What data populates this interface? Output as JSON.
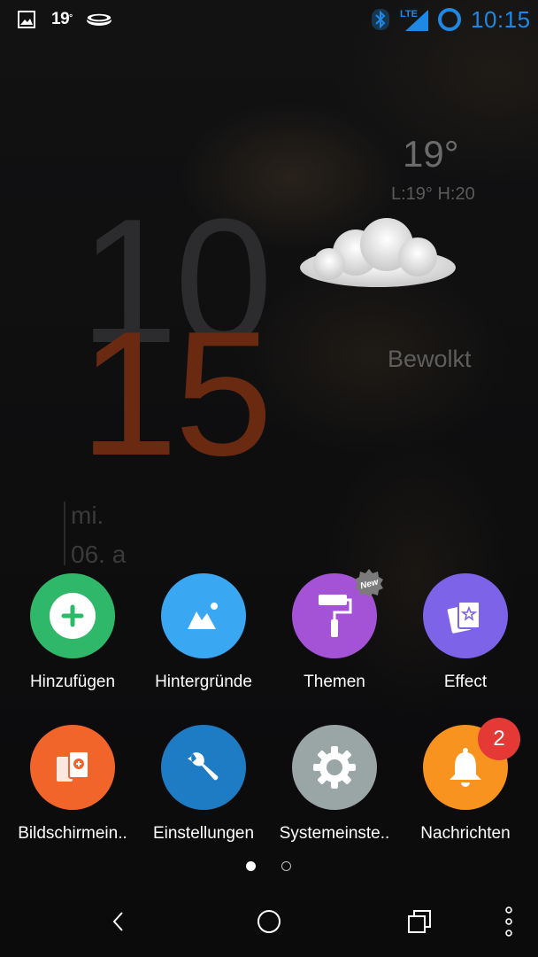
{
  "status_bar": {
    "temperature": "19",
    "temp_unit": "°",
    "time": "10:15",
    "network": "LTE",
    "icons": [
      "gallery-icon",
      "weather-temp",
      "oval-badge-icon",
      "bluetooth-icon",
      "lte-signal-icon",
      "sync-ring-icon"
    ]
  },
  "weather": {
    "temperature": "19°",
    "range": "L:19°  H:20",
    "condition": "Bewolkt"
  },
  "clock": {
    "hour": "10",
    "minute": "15",
    "day": "mi.",
    "date": "06. a"
  },
  "menu": {
    "items": [
      {
        "label": "Hinzufügen",
        "color": "#2fb869",
        "icon": "plus-icon"
      },
      {
        "label": "Hintergründe",
        "color": "#3aa7f2",
        "icon": "picture-icon"
      },
      {
        "label": "Themen",
        "color": "#a453d6",
        "icon": "paint-roller-icon",
        "badge": "New"
      },
      {
        "label": "Effect",
        "color": "#7d63e8",
        "icon": "cards-star-icon"
      },
      {
        "label": "Bildschirmein..",
        "color": "#f2652a",
        "icon": "screens-icon"
      },
      {
        "label": "Einstellungen",
        "color": "#1e7cc4",
        "icon": "wrench-icon"
      },
      {
        "label": "Systemeinste..",
        "color": "#9aa5a6",
        "icon": "gear-icon"
      },
      {
        "label": "Nachrichten",
        "color": "#f7931e",
        "icon": "bell-icon",
        "badge_count": "2"
      }
    ]
  },
  "pager": {
    "pages": 2,
    "current": 1
  },
  "navbar": {
    "icons": [
      "back-icon",
      "home-icon",
      "recents-icon",
      "more-icon"
    ]
  },
  "colors": {
    "accent": "#1e88e5",
    "clock_minute": "#6a2a12",
    "badge": "#e53935"
  }
}
